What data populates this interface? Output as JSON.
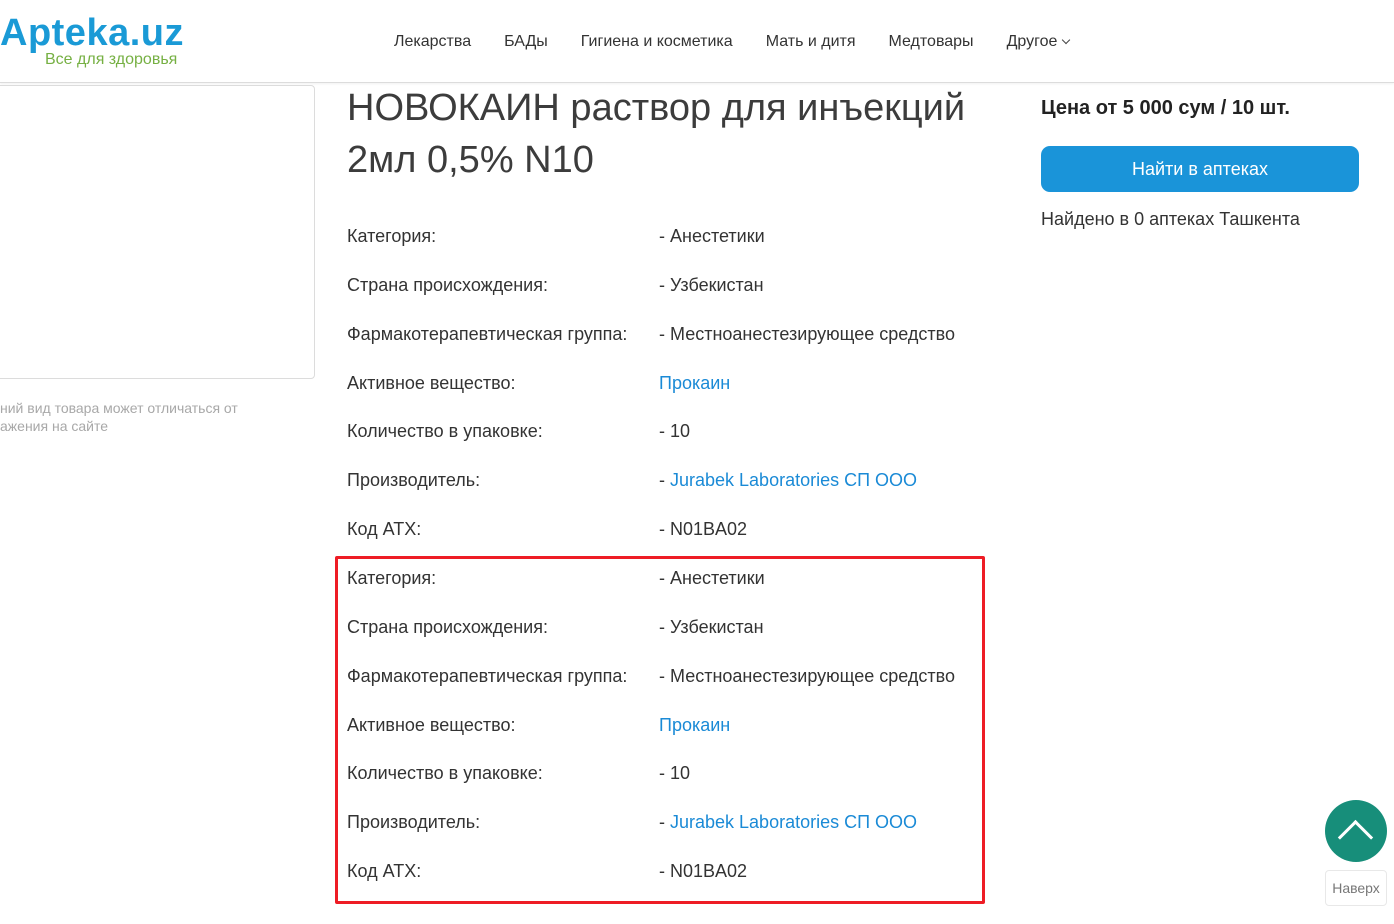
{
  "header": {
    "logo_main": "Apteka.uz",
    "logo_sub": "Все для здоровья",
    "nav": [
      "Лекарства",
      "БАДы",
      "Гигиена и косметика",
      "Мать и дитя",
      "Медтовары",
      "Другое"
    ]
  },
  "image_note": {
    "line1": "ний вид товара может отличаться от",
    "line2": "ажения на сайте"
  },
  "product": {
    "title": "НОВОКАИН раствор для инъекций 2мл 0,5% N10",
    "info_1": [
      {
        "label": "Категория:",
        "value": "- Анестетики"
      },
      {
        "label": "Страна происхождения:",
        "value": "- Узбекистан"
      },
      {
        "label": "Фармакотерапевтическая группа:",
        "value": "- Местноанестезирующее средство"
      },
      {
        "label": "Активное вещество:",
        "value": "Прокаин"
      },
      {
        "label": "Количество в упаковке:",
        "value": "- 10"
      },
      {
        "label": "Производитель:",
        "dash": "- ",
        "value": "Jurabek Laboratories СП ООО"
      },
      {
        "label": "Код АТХ:",
        "value": "- N01BA02"
      }
    ],
    "info_2": [
      {
        "label": "Категория:",
        "value": "- Анестетики"
      },
      {
        "label": "Страна происхождения:",
        "value": "- Узбекистан"
      },
      {
        "label": "Фармакотерапевтическая группа:",
        "value": "- Местноанестезирующее средство"
      },
      {
        "label": "Активное вещество:",
        "value": "Прокаин"
      },
      {
        "label": "Количество в упаковке:",
        "value": "- 10"
      },
      {
        "label": "Производитель:",
        "dash": "- ",
        "value": "Jurabek Laboratories СП ООО"
      },
      {
        "label": "Код АТХ:",
        "value": "- N01BA02"
      }
    ]
  },
  "sidebar": {
    "price": "Цена от 5 000 сум / 10 шт.",
    "find_button": "Найти в аптеках",
    "found": "Найдено в 0 аптеках Ташкента"
  },
  "back_to_top": {
    "label": "Наверх",
    "icon": "chevron-up-icon"
  },
  "colors": {
    "brand_blue": "#1a9ad6",
    "brand_green": "#76b043",
    "button_blue": "#1a94d9",
    "link_blue": "#1a8ad6",
    "highlight_red": "#ee1c25",
    "top_button_teal": "#178e7a"
  }
}
